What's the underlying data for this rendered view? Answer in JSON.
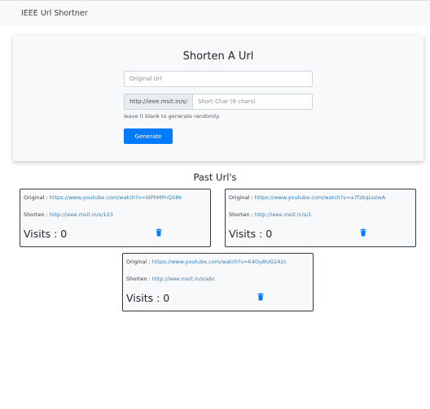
{
  "navbar": {
    "brand": "IEEE Url Shortner"
  },
  "form": {
    "title": "Shorten A Url",
    "original_placeholder": "Original Url",
    "prefix": "http://ieee.msit.in/s/",
    "short_placeholder": "Short Char (6 chars)",
    "hint": "leave it blank to generate randomly.",
    "generate_label": "Generate"
  },
  "past": {
    "title": "Past Url's",
    "original_label": "Original :",
    "shorten_label": "Shorten :",
    "items": [
      {
        "original": "https://www.youtube.com/watch?v=SlPhMPnQ58k",
        "short": "http://ieee.msit.in/s/123",
        "visits": "Visits : 0"
      },
      {
        "original": "https://www.youtube.com/watch?v=a7fzkqLozwA",
        "short": "http://ieee.msit.in/s/1",
        "visits": "Visits : 0"
      },
      {
        "original": "https://www.youtube.com/watch?v=K4DyBUG242c",
        "short": "http://ieee.msit.in/s/abc",
        "visits": "Visits : 0"
      }
    ]
  },
  "colors": {
    "accent": "#007bff",
    "link": "#2f7ec4"
  },
  "icons": {
    "delete": "trash-icon"
  }
}
